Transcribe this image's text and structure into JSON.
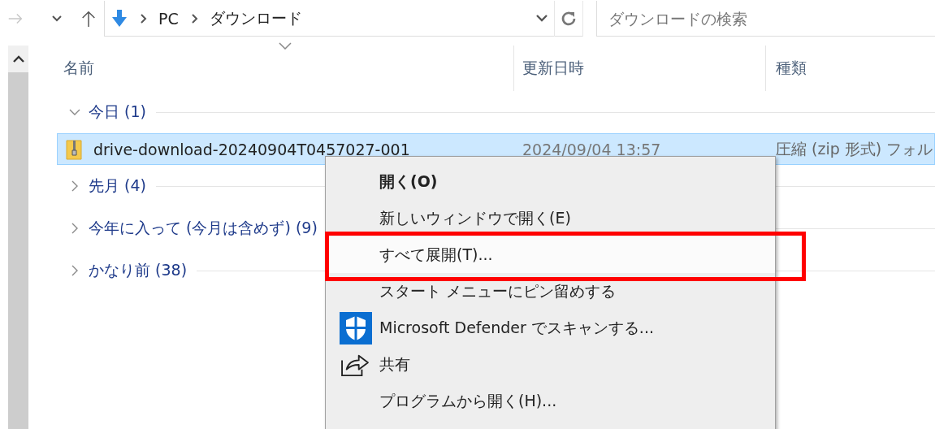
{
  "toolbar": {
    "forward_disabled": true,
    "address": [
      "PC",
      "ダウンロード"
    ],
    "search": {
      "placeholder": "ダウンロードの検索"
    }
  },
  "columns": [
    {
      "label": "名前",
      "sorted": true
    },
    {
      "label": "更新日時",
      "sorted": false
    },
    {
      "label": "種類",
      "sorted": false
    }
  ],
  "groups": [
    {
      "label": "今日 (1)",
      "expanded": true,
      "files": [
        {
          "name": "drive-download-20240904T0457027-001",
          "modified": "2024/09/04 13:57",
          "type": "圧縮 (zip 形式) フォル",
          "selected": true
        }
      ]
    },
    {
      "label": "先月 (4)",
      "expanded": false
    },
    {
      "label": "今年に入って (今月は含めず) (9)",
      "expanded": false
    },
    {
      "label": "かなり前 (38)",
      "expanded": false
    }
  ],
  "context_menu": {
    "items": [
      {
        "label": "開く(O)",
        "kind": "bold",
        "selected": false,
        "annotated": false
      },
      {
        "label": "新しいウィンドウで開く(E)",
        "kind": "plain",
        "selected": false,
        "annotated": false
      },
      {
        "label": "すべて展開(T)...",
        "kind": "plain",
        "selected": true,
        "annotated": true
      },
      {
        "label": "スタート メニューにピン留めする",
        "kind": "plain",
        "selected": false,
        "annotated": false
      },
      {
        "label": "Microsoft Defender でスキャンする...",
        "kind": "shield",
        "selected": false,
        "annotated": false
      },
      {
        "label": "共有",
        "kind": "share",
        "selected": false,
        "annotated": false
      },
      {
        "label": "プログラムから開く(H)...",
        "kind": "plain",
        "selected": false,
        "annotated": false
      }
    ]
  }
}
